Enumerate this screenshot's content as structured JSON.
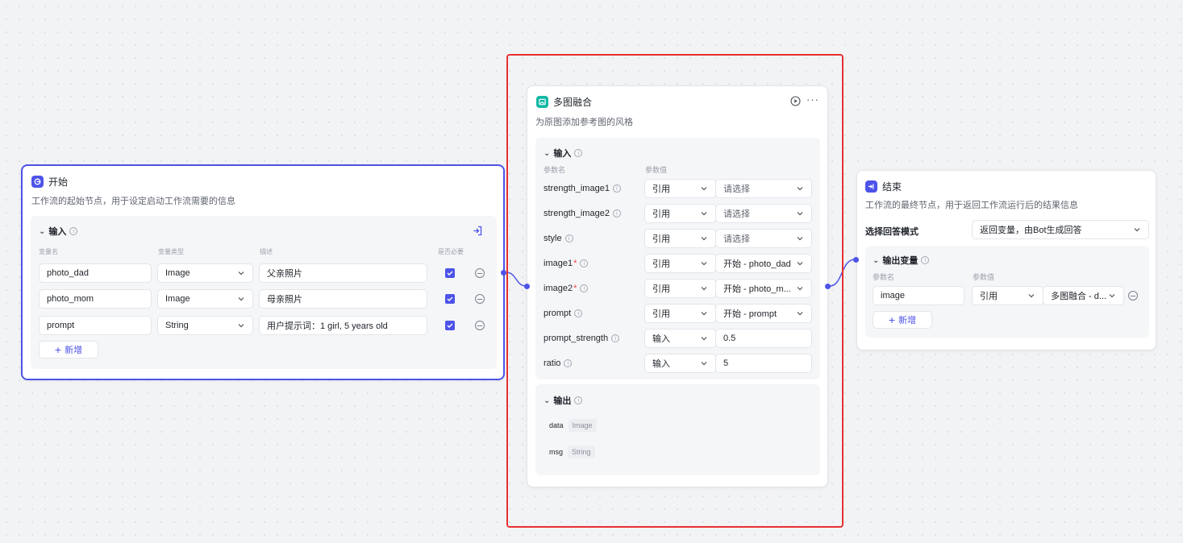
{
  "start_node": {
    "title": "开始",
    "description": "工作流的起始节点，用于设定启动工作流需要的信息",
    "input_section": {
      "title": "输入",
      "col_name": "变量名",
      "col_type": "变量类型",
      "col_desc": "描述",
      "col_required": "是否必要",
      "rows": [
        {
          "name": "photo_dad",
          "type": "Image",
          "desc": "父亲照片"
        },
        {
          "name": "photo_mom",
          "type": "Image",
          "desc": "母亲照片"
        },
        {
          "name": "prompt",
          "type": "String",
          "desc": "用户提示词：1 girl, 5 years old"
        }
      ],
      "add_label": "新增"
    }
  },
  "fusion_node": {
    "title": "多图融合",
    "description": "为原图添加参考图的风格",
    "input_section": {
      "title": "输入",
      "col_name": "参数名",
      "col_value": "参数值",
      "params": [
        {
          "name": "strength_image1",
          "required": false,
          "mode": "引用",
          "value": "请选择",
          "placeholder": true
        },
        {
          "name": "strength_image2",
          "required": false,
          "mode": "引用",
          "value": "请选择",
          "placeholder": true
        },
        {
          "name": "style",
          "required": false,
          "mode": "引用",
          "value": "请选择",
          "placeholder": true
        },
        {
          "name": "image1",
          "required": true,
          "mode": "引用",
          "value": "开始 - photo_dad",
          "placeholder": false
        },
        {
          "name": "image2",
          "required": true,
          "mode": "引用",
          "value": "开始 - photo_m...",
          "placeholder": false
        },
        {
          "name": "prompt",
          "required": false,
          "mode": "引用",
          "value": "开始 - prompt",
          "placeholder": false
        },
        {
          "name": "prompt_strength",
          "required": false,
          "mode": "输入",
          "value": "0.5",
          "placeholder": false
        },
        {
          "name": "ratio",
          "required": false,
          "mode": "输入",
          "value": "5",
          "placeholder": false
        }
      ]
    },
    "output_section": {
      "title": "输出",
      "outputs": [
        {
          "name": "data",
          "type": "Image"
        },
        {
          "name": "msg",
          "type": "String"
        }
      ]
    }
  },
  "end_node": {
    "title": "结束",
    "description": "工作流的最终节点，用于返回工作流运行后的结果信息",
    "answer_mode_label": "选择回答模式",
    "answer_mode_value": "返回变量，由Bot生成回答",
    "output_section": {
      "title": "输出变量",
      "col_name": "参数名",
      "col_value": "参数值",
      "rows": [
        {
          "name": "image",
          "mode": "引用",
          "value": "多图融合 - d..."
        }
      ],
      "add_label": "新增"
    }
  },
  "colors": {
    "accent": "#4d53e8",
    "highlight": "#e63131",
    "fusion_icon": "#14b8a6"
  },
  "icons": {
    "start": "start-icon",
    "fusion": "image-fusion-icon",
    "end": "end-icon",
    "run": "play-circle-icon",
    "more": "more-horizontal-icon"
  }
}
